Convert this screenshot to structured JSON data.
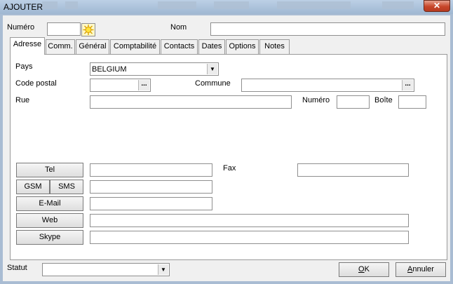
{
  "window": {
    "title": "AJOUTER",
    "close_glyph": "✕"
  },
  "header": {
    "numero_label": "Numéro",
    "numero_value": "",
    "nom_label": "Nom",
    "nom_value": ""
  },
  "tabs": [
    {
      "label": "Adresse",
      "active": true
    },
    {
      "label": "Comm."
    },
    {
      "label": "Général"
    },
    {
      "label": "Comptabilité"
    },
    {
      "label": "Contacts"
    },
    {
      "label": "Dates"
    },
    {
      "label": "Options"
    },
    {
      "label": "Notes"
    }
  ],
  "address": {
    "pays_label": "Pays",
    "pays_value": "BELGIUM",
    "code_postal_label": "Code postal",
    "code_postal_value": "",
    "commune_label": "Commune",
    "commune_value": "",
    "rue_label": "Rue",
    "rue_value": "",
    "numero_label": "Numéro",
    "numero_value": "",
    "boite_label": "Boîte",
    "boite_value": "",
    "browse_glyph": "..."
  },
  "contact": {
    "tel_button": "Tel",
    "tel_value": "",
    "fax_label": "Fax",
    "fax_value": "",
    "gsm_button": "GSM",
    "sms_button": "SMS",
    "gsm_value": "",
    "email_button": "E-Mail",
    "email_value": "",
    "web_button": "Web",
    "web_value": "",
    "skype_button": "Skype",
    "skype_value": ""
  },
  "footer": {
    "statut_label": "Statut",
    "statut_value": "",
    "ok_access": "O",
    "ok_rest": "K",
    "annuler_access": "A",
    "annuler_rest": "nnuler"
  },
  "icons": {
    "new_number": "sun-icon",
    "dropdown": "chevron-down-icon",
    "close": "close-icon"
  }
}
